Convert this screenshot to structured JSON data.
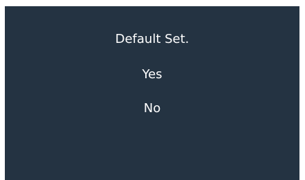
{
  "dialog": {
    "title": "Default Set.",
    "options": [
      {
        "label": "Yes"
      },
      {
        "label": "No"
      }
    ]
  },
  "colors": {
    "background": "#243342",
    "text": "#ffffff"
  }
}
